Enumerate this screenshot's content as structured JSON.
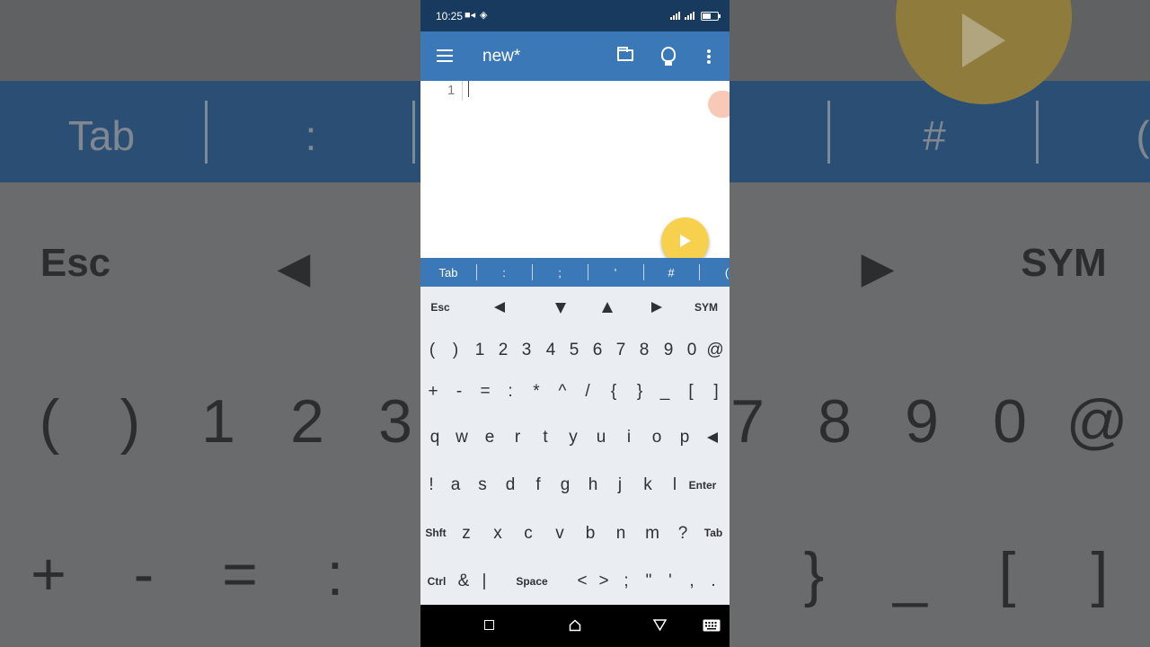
{
  "status_bar": {
    "time": "10:25"
  },
  "app_bar": {
    "title": "new*"
  },
  "editor": {
    "line_numbers": [
      "1"
    ]
  },
  "symbol_bar": {
    "keys": [
      "Tab",
      ":",
      ";",
      "'",
      "#",
      "("
    ]
  },
  "keyboard": {
    "row1": [
      "Esc",
      "SYM"
    ],
    "row2": [
      "(",
      ")",
      "1",
      "2",
      "3",
      "4",
      "5",
      "6",
      "7",
      "8",
      "9",
      "0",
      "@"
    ],
    "row3": [
      "+",
      "-",
      "=",
      ":",
      "*",
      "^",
      "/",
      "{",
      "}",
      "_",
      "[",
      "]"
    ],
    "row4": [
      "q",
      "w",
      "e",
      "r",
      "t",
      "y",
      "u",
      "i",
      "o",
      "p"
    ],
    "row5": [
      "!",
      "a",
      "s",
      "d",
      "f",
      "g",
      "h",
      "j",
      "k",
      "l",
      "Enter"
    ],
    "row6": [
      "Shft",
      "z",
      "x",
      "c",
      "v",
      "b",
      "n",
      "m",
      "?",
      "Tab"
    ],
    "row7": [
      "Ctrl",
      "&",
      "|",
      "Space",
      "<",
      ">",
      ";",
      "\"",
      "'",
      ",",
      "."
    ]
  },
  "background_zoom": {
    "toolbar": [
      "Tab",
      ":",
      "#",
      "("
    ],
    "keys_row1": [
      "Esc",
      "SYM"
    ],
    "keys_row2": [
      "(",
      ")",
      "1",
      "2",
      "3",
      "7",
      "8",
      "9",
      "0",
      "@"
    ],
    "keys_row3": [
      "+",
      "-",
      "=",
      ":",
      "}",
      "_",
      "[",
      "]"
    ]
  },
  "colors": {
    "accent": "#3a78b7",
    "status_bar": "#173a5e",
    "fab": "#f7d04e",
    "keyboard_bg": "#eaedf1"
  },
  "icons": [
    "video-icon",
    "layers-icon",
    "signal-icon",
    "battery-icon",
    "menu-icon",
    "folder-icon",
    "lightbulb-icon",
    "more-vert-icon",
    "play-icon",
    "recent-apps-icon",
    "home-icon",
    "back-icon",
    "keyboard-icon"
  ]
}
